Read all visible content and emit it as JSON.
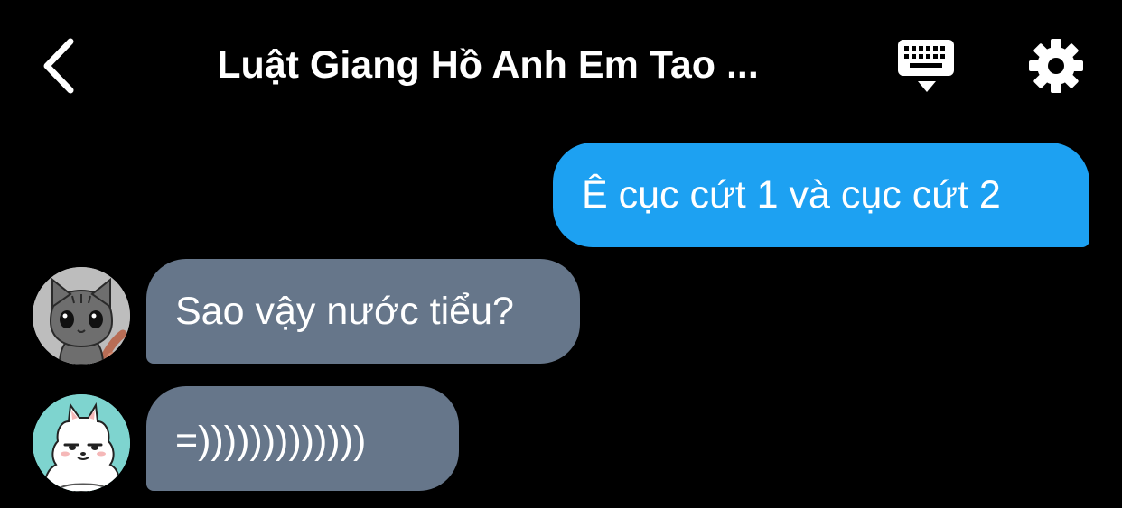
{
  "header": {
    "back_icon": "chevron-left-icon",
    "title": "Luật Giang Hồ Anh Em Tao ...",
    "keyboard_icon": "keyboard-icon",
    "settings_icon": "gear-icon"
  },
  "messages": [
    {
      "direction": "outgoing",
      "text": "Ê cục cứt 1 và cục cứt 2",
      "color": "#1da1f2"
    },
    {
      "direction": "incoming",
      "avatar": "gray-cat-avatar",
      "text": "Sao vậy nước tiểu?",
      "color": "#66768a"
    },
    {
      "direction": "incoming",
      "avatar": "white-dog-avatar",
      "text": "=)))))))))))))",
      "color": "#66768a"
    }
  ],
  "colors": {
    "background": "#000000",
    "outgoing_bubble": "#1da1f2",
    "incoming_bubble": "#66768a",
    "text": "#ffffff"
  }
}
